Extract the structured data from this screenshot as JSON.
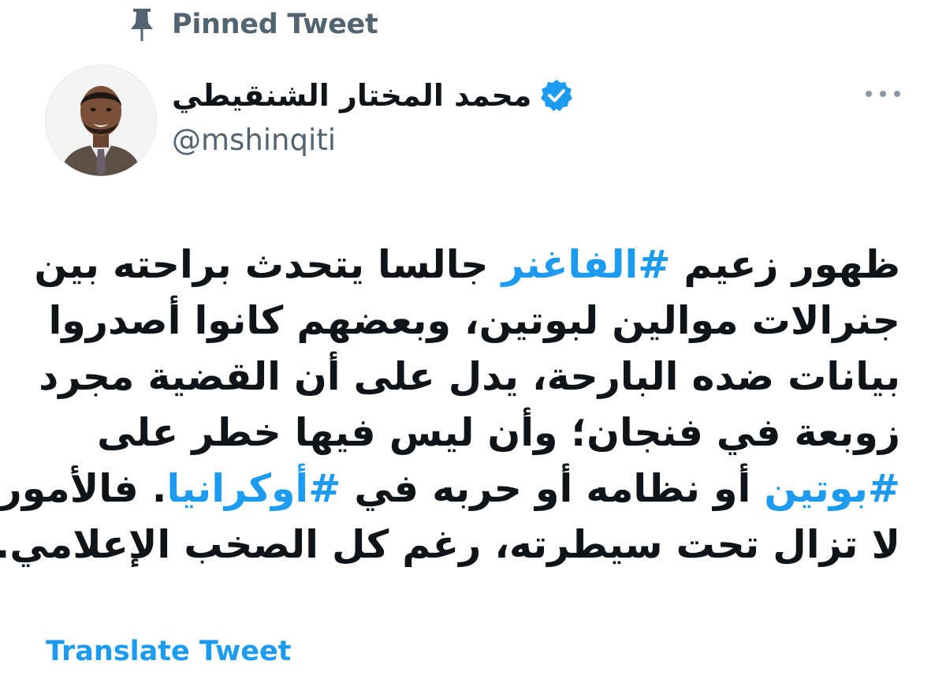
{
  "pinned": {
    "label": "Pinned Tweet",
    "icon": "pin-icon"
  },
  "author": {
    "name": "محمد المختار الشنقيطي",
    "handle": "@mshinqiti",
    "verified": true,
    "verified_icon": "verified-badge-icon",
    "avatar": "avatar-photo"
  },
  "more_icon": "more-options-icon",
  "tweet": {
    "lines": [
      {
        "pre": "ظهور زعيم ",
        "tag": "#الفاغنر",
        "post": " جالسا يتحدث براحته بين"
      },
      {
        "pre": "جنرالات موالين لبوتين، وبعضهم كانوا أصدروا",
        "tag": "",
        "post": ""
      },
      {
        "pre": "بيانات ضده البارحة، يدل على أن القضية مجرد",
        "tag": "",
        "post": ""
      },
      {
        "pre": "زوبعة في فنجان؛ وأن ليس فيها خطر على",
        "tag": "",
        "post": ""
      },
      {
        "pre": "",
        "tag": "#بوتين",
        "post": " أو نظامه أو حربه في "
      },
      {
        "pre": "",
        "tag": "#أوكرانيا",
        "post": ". فالأمور"
      },
      {
        "pre": "لا تزال تحت سيطرته، رغم كل الصخب الإعلامي.",
        "tag": "",
        "post": ""
      }
    ]
  },
  "translate_label": "Translate Tweet",
  "colors": {
    "link": "#1d9bf0",
    "secondary_text": "#536471",
    "primary_text": "#0f1419",
    "background": "#ffffff"
  }
}
